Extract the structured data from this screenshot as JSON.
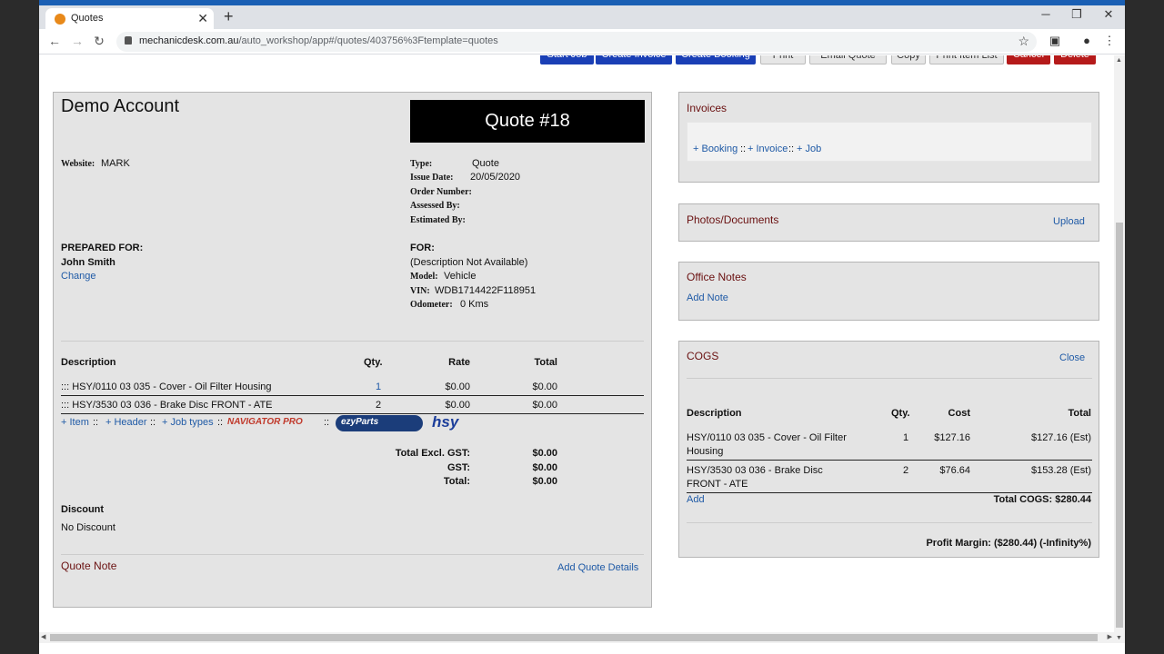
{
  "browser": {
    "tab_title": "Quotes",
    "tab_close": "✕",
    "new_tab": "+",
    "url_host": "mechanicdesk.com.au",
    "url_path": "/auto_workshop/app#/quotes/403756%3Ftemplate=quotes",
    "min": "─",
    "restore": "❐",
    "close": "✕"
  },
  "toolbar": {
    "buttons": [
      "Start Job",
      "Create Invoice",
      "Create Booking",
      "Print",
      "Email Quote",
      "Copy",
      "Print Item List",
      "Cancel",
      "Delete"
    ]
  },
  "quote": {
    "account_name": "Demo Account",
    "title": "Quote #18",
    "website_label": "Website:",
    "website_value": "MARK",
    "type_label": "Type:",
    "type_value": "Quote",
    "issue_label": "Issue Date:",
    "issue_value": "20/05/2020",
    "order_label": "Order Number:",
    "assessed_label": "Assessed By:",
    "estimated_label": "Estimated By:",
    "prepared_for_label": "PREPARED FOR:",
    "customer_name": "John Smith",
    "change_link": "Change",
    "for_label": "FOR:",
    "vehicle_desc": "(Description Not Available)",
    "model_label": "Model:",
    "model_value": "Vehicle",
    "vin_label": "VIN:",
    "vin_value": "WDB1714422F118951",
    "odometer_label": "Odometer:",
    "odometer_value": "0 Kms",
    "columns": {
      "description": "Description",
      "qty": "Qty.",
      "rate": "Rate",
      "total": "Total"
    },
    "items": [
      {
        "desc": "::: HSY/0110 03 035 - Cover - Oil Filter Housing",
        "qty": "1",
        "rate": "$0.00",
        "total": "$0.00"
      },
      {
        "desc": "::: HSY/3530 03 036 - Brake Disc FRONT - ATE",
        "qty": "2",
        "rate": "$0.00",
        "total": "$0.00"
      }
    ],
    "add_item": "+ Item",
    "add_header": "+ Header",
    "add_job_types": "+ Job types",
    "sep": "::",
    "logos": {
      "navigator": "NAVIGATOR PRO",
      "ezyparts": "ezyParts",
      "hsy": "hsy"
    },
    "totals": {
      "excl_label": "Total Excl. GST:",
      "excl_value": "$0.00",
      "gst_label": "GST:",
      "gst_value": "$0.00",
      "total_label": "Total:",
      "total_value": "$0.00"
    },
    "discount_label": "Discount",
    "discount_value": "No Discount",
    "note_label": "Quote Note",
    "add_details": "Add Quote Details"
  },
  "invoices": {
    "title": "Invoices",
    "booking": "+ Booking",
    "invoice": "+ Invoice",
    "job": "+ Job",
    "sep": "::"
  },
  "photos": {
    "title": "Photos/Documents",
    "upload": "Upload"
  },
  "office_notes": {
    "title": "Office Notes",
    "add": "Add Note"
  },
  "cogs": {
    "title": "COGS",
    "close": "Close",
    "columns": {
      "description": "Description",
      "qty": "Qty.",
      "cost": "Cost",
      "total": "Total"
    },
    "items": [
      {
        "desc_line1": "HSY/0110 03 035 - Cover - Oil Filter",
        "desc_line2": "Housing",
        "qty": "1",
        "cost": "$127.16",
        "total": "$127.16 (Est)"
      },
      {
        "desc_line1": "HSY/3530 03 036 - Brake Disc",
        "desc_line2": "FRONT - ATE",
        "qty": "2",
        "cost": "$76.64",
        "total": "$153.28 (Est)"
      }
    ],
    "add": "Add",
    "total_cogs": "Total COGS: $280.44",
    "profit_margin": "Profit Margin: ($280.44) (-Infinity%)"
  },
  "colors": {
    "link": "#1f5aa6",
    "heading": "#6a1010",
    "action_blue": "#1a3fb5",
    "action_red": "#b51a1a"
  }
}
